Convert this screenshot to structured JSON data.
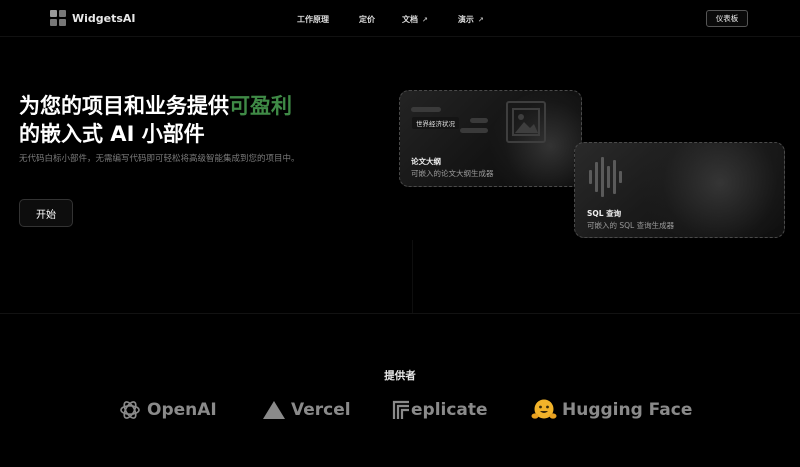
{
  "brand": {
    "name": "WidgetsAI"
  },
  "nav": {
    "items": [
      {
        "label": "工作原理",
        "external": false
      },
      {
        "label": "定价",
        "external": false
      },
      {
        "label": "文档",
        "external": true
      },
      {
        "label": "演示",
        "external": true
      }
    ],
    "external_arrow": "↗",
    "dashboard_label": "仪表板"
  },
  "hero": {
    "title_prefix": "为您的项目和业务提供",
    "title_highlight": "可盈利",
    "title_suffix": "的嵌入式 AI 小部件",
    "subtitle": "无代码白标小部件，无需编写代码即可轻松将高级智能集成到您的项目中。",
    "cta_label": "开始"
  },
  "cards": [
    {
      "tag": "世界经济状况",
      "title": "论文大纲",
      "description": "可嵌入的论文大纲生成器"
    },
    {
      "title": "SQL 查询",
      "description": "可嵌入的 SQL 查询生成器"
    }
  ],
  "providers": {
    "title": "提供者",
    "items": [
      {
        "name": "OpenAI",
        "icon": "openai-logo-icon"
      },
      {
        "name": "Vercel",
        "icon": "vercel-triangle-icon"
      },
      {
        "name": "eplicate",
        "icon": "replicate-logo-icon"
      },
      {
        "name": "Hugging Face",
        "icon": "hugging-face-emoji-icon"
      }
    ]
  },
  "colors": {
    "background": "#000000",
    "highlight_green": "#3f8a46",
    "muted_text": "#7a7a7a",
    "provider_gray": "#8a8a8a",
    "hugging_face_yellow": "#f2b32a"
  }
}
